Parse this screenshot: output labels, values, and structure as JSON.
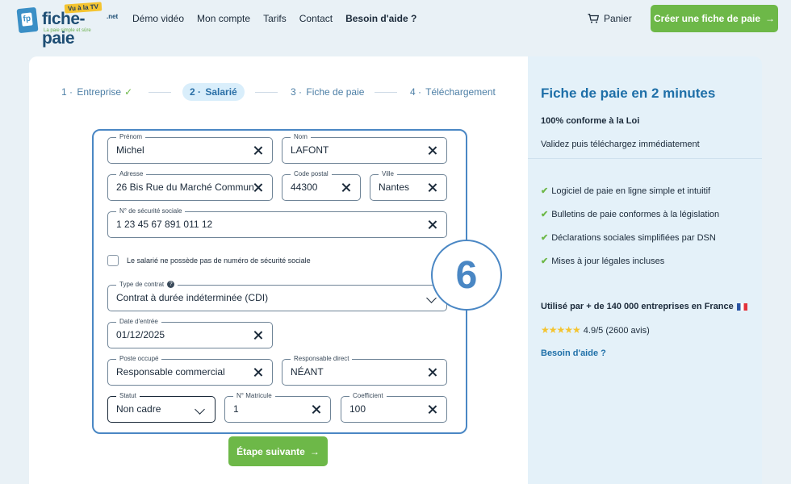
{
  "header": {
    "logo_text": "fiche-paie",
    "logo_tld": ".net",
    "logo_tag": "Vu à la TV",
    "logo_sub": "La paie simple et sûre",
    "nav": [
      "Démo vidéo",
      "Mon compte",
      "Tarifs",
      "Contact",
      "Besoin d'aide ?"
    ],
    "cart": "Panier",
    "cta": "Créer une fiche de paie"
  },
  "stepper": {
    "steps": [
      {
        "num": "1 ·",
        "label": "Entreprise",
        "done": true
      },
      {
        "num": "2 ·",
        "label": "Salarié",
        "active": true
      },
      {
        "num": "3 ·",
        "label": "Fiche de paie"
      },
      {
        "num": "4 ·",
        "label": "Téléchargement"
      }
    ]
  },
  "form": {
    "prenom": {
      "label": "Prénom",
      "value": "Michel"
    },
    "nom": {
      "label": "Nom",
      "value": "LAFONT"
    },
    "adresse": {
      "label": "Adresse",
      "value": "26 Bis Rue du Marché Commun"
    },
    "code_postal": {
      "label": "Code postal",
      "value": "44300"
    },
    "ville": {
      "label": "Ville",
      "value": "Nantes"
    },
    "secu": {
      "label": "N° de sécurité sociale",
      "value": "1 23 45 67 891 011 12"
    },
    "no_secu_checkbox": "Le salarié ne possède pas de numéro de sécurité sociale",
    "type_contrat": {
      "label": "Type de contrat",
      "value": "Contrat à durée indéterminée (CDI)"
    },
    "date_entree": {
      "label": "Date d'entrée",
      "value": "01/12/2025"
    },
    "poste": {
      "label": "Poste occupé",
      "value": "Responsable commercial"
    },
    "responsable": {
      "label": "Responsable direct",
      "value": "NÉANT"
    },
    "statut": {
      "label": "Statut",
      "value": "Non cadre"
    },
    "matricule": {
      "label": "N° Matricule",
      "value": "1"
    },
    "coefficient": {
      "label": "Coefficient",
      "value": "100"
    }
  },
  "badge": "6",
  "next_button": "Étape suivante",
  "side": {
    "title": "Fiche de paie en 2 minutes",
    "subtitle": "100% conforme à la Loi",
    "desc": "Validez puis téléchargez immédiatement",
    "features": [
      "Logiciel de paie en ligne simple et intuitif",
      "Bulletins de paie conformes à la législation",
      "Déclarations sociales simplifiées par DSN",
      "Mises à jour légales incluses"
    ],
    "used_by": "Utilisé par + de 140 000 entreprises en France",
    "rating": "4.9/5 (2600 avis)",
    "rating_value": 4.9,
    "help": "Besoin d'aide ?"
  },
  "colors": {
    "accent_green": "#6db848",
    "accent_blue": "#4a87c4",
    "title_blue": "#1e6fa8"
  }
}
